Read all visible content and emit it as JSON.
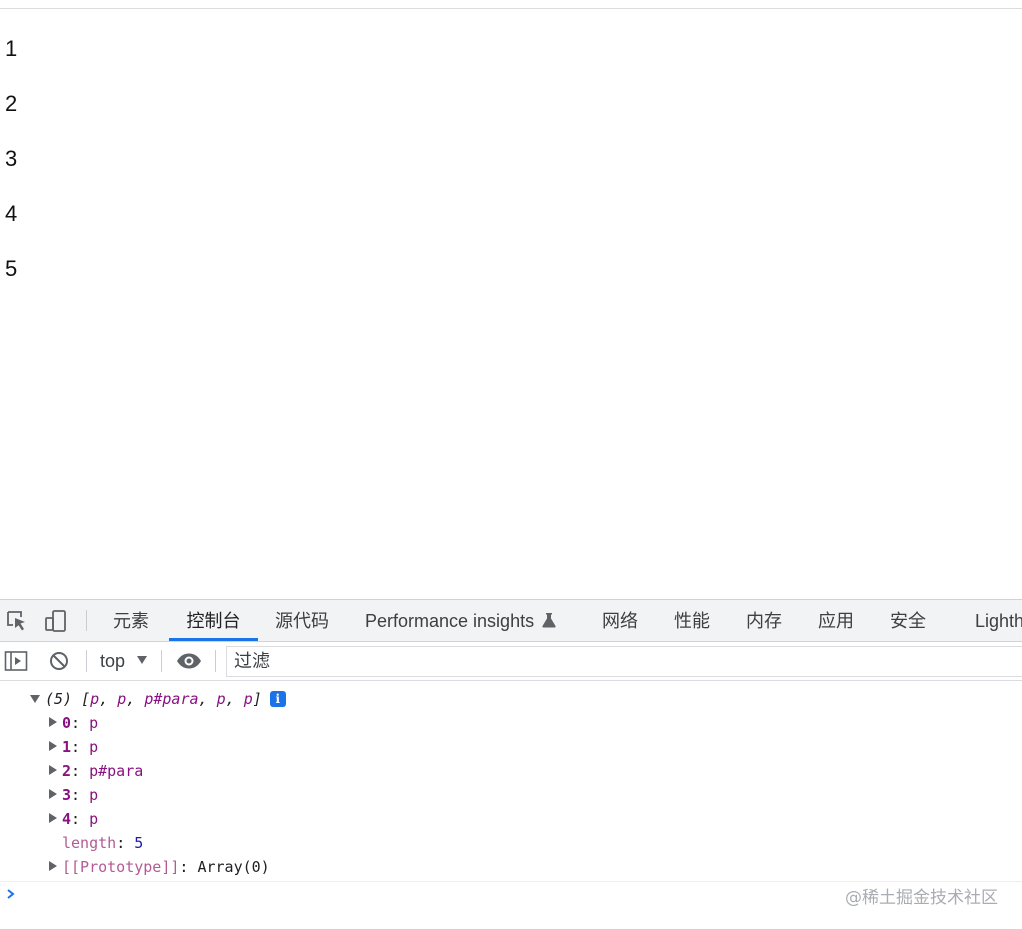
{
  "page": {
    "paragraphs": [
      "1",
      "2",
      "3",
      "4",
      "5"
    ]
  },
  "devtools": {
    "tabs": [
      {
        "label": "元素"
      },
      {
        "label": "控制台",
        "active": true
      },
      {
        "label": "源代码"
      },
      {
        "label": "Performance insights"
      },
      {
        "label": "网络"
      },
      {
        "label": "性能"
      },
      {
        "label": "内存"
      },
      {
        "label": "应用"
      },
      {
        "label": "安全"
      },
      {
        "label": "Lighth"
      }
    ],
    "toolbar": {
      "context": "top",
      "filter_placeholder": "过滤"
    },
    "console": {
      "summary": {
        "count": "(5)",
        "items": [
          "p",
          "p",
          "p#para",
          "p",
          "p"
        ]
      },
      "info_icon": "i",
      "entries": [
        {
          "key": "0",
          "value": "p"
        },
        {
          "key": "1",
          "value": "p"
        },
        {
          "key": "2",
          "value": "p#para"
        },
        {
          "key": "3",
          "value": "p"
        },
        {
          "key": "4",
          "value": "p"
        }
      ],
      "length": {
        "key": "length",
        "value": "5"
      },
      "prototype": {
        "key": "[[Prototype]]",
        "value": "Array(0)"
      }
    },
    "watermark": "@稀土掘金技术社区"
  },
  "colors": {
    "accent": "#1a73e8",
    "node": "#881280",
    "number": "#1a1aa6"
  },
  "icons": [
    "inspect-element-icon",
    "device-toolbar-icon",
    "flask-icon",
    "sidebar-toggle-icon",
    "clear-console-icon",
    "dropdown-arrow-icon",
    "eye-icon",
    "info-icon",
    "prompt-chevron-icon"
  ]
}
